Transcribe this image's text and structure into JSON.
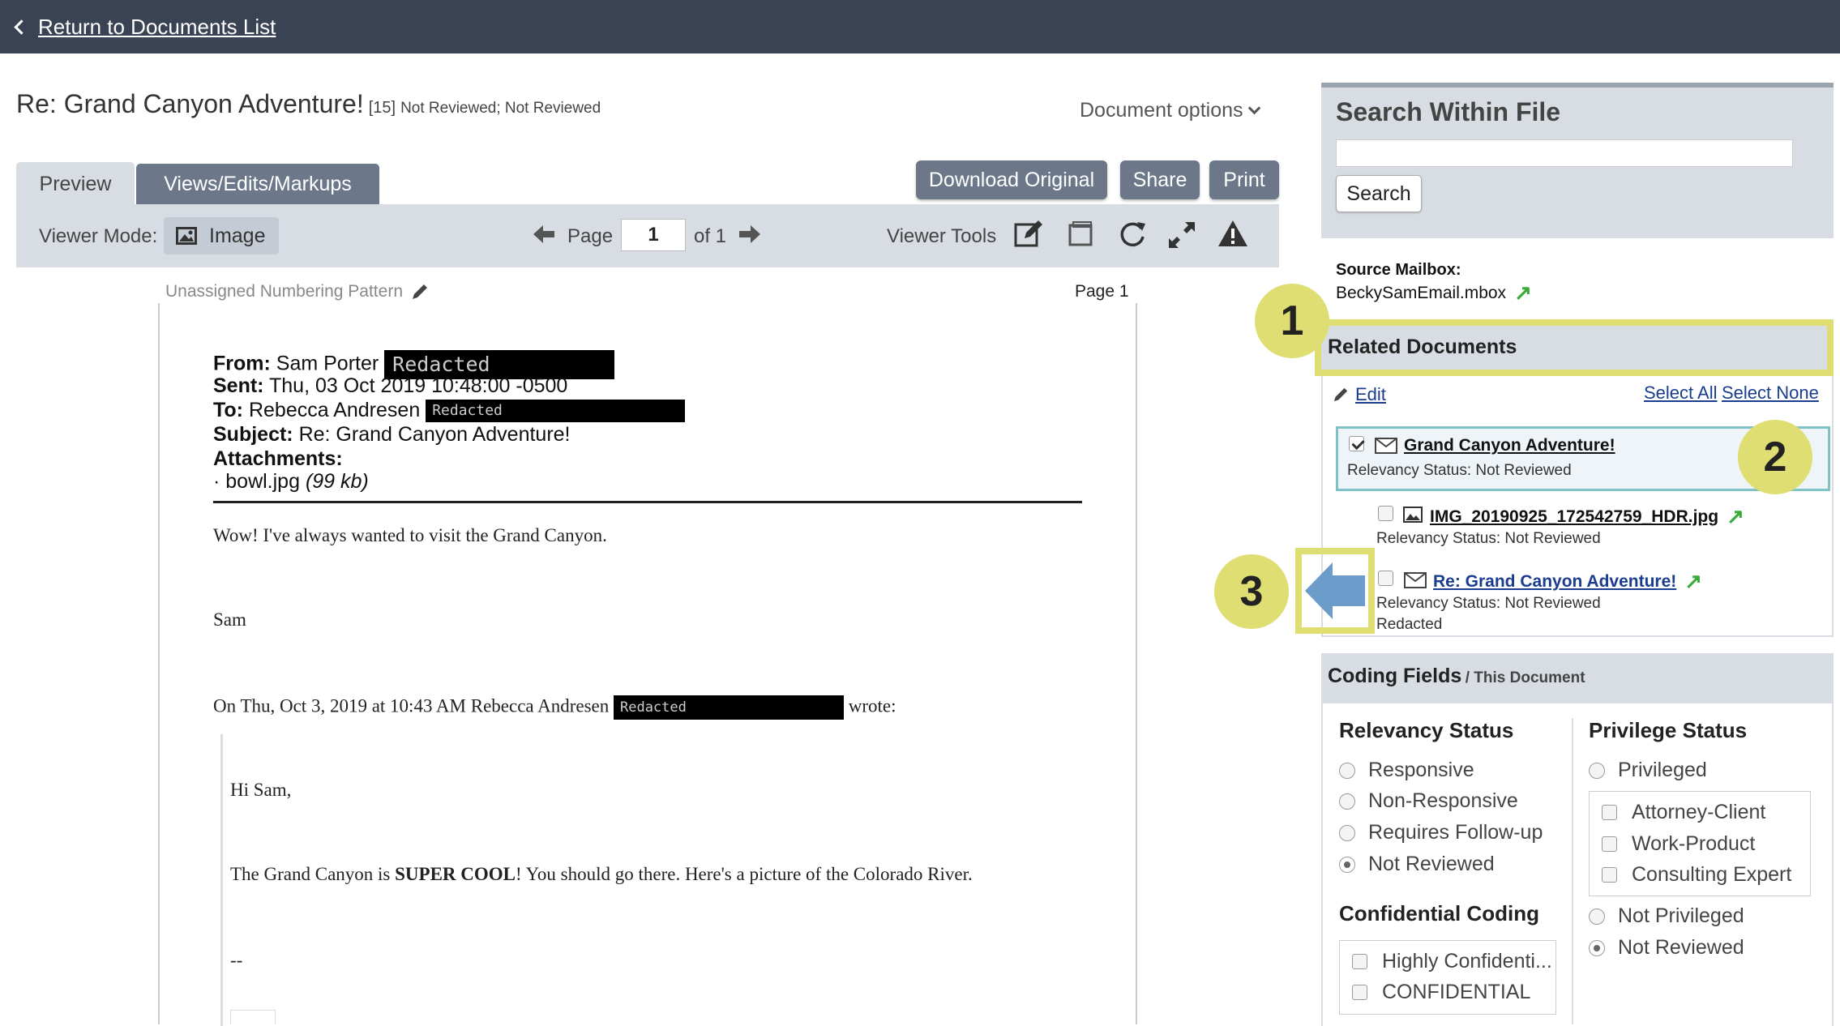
{
  "topbar": {
    "back_label": "Return to Documents List"
  },
  "document": {
    "title": "Re: Grand Canyon Adventure!",
    "number": "[15]",
    "status": "Not Reviewed; Not Reviewed",
    "options_label": "Document options"
  },
  "tabs": [
    {
      "label": "Preview"
    },
    {
      "label": "Views/Edits/Markups"
    }
  ],
  "actions": {
    "download": "Download Original",
    "share": "Share",
    "print": "Print"
  },
  "viewer": {
    "mode_label": "Viewer Mode:",
    "mode_value": "Image",
    "page_label": "Page",
    "page_value": "1",
    "of_label": "of 1",
    "tools_label": "Viewer Tools"
  },
  "page": {
    "numbering": "Unassigned Numbering Pattern",
    "page_label": "Page 1",
    "from_label": "From:",
    "from_value": "Sam Porter",
    "sent_label": "Sent:",
    "sent_value": "Thu, 03 Oct 2019 10:48:00 -0500",
    "to_label": "To:",
    "to_value": "Rebecca Andresen",
    "subject_label": "Subject:",
    "subject_value": "Re: Grand Canyon Adventure!",
    "attachments_label": "Attachments:",
    "attachment_name": "· bowl.jpg",
    "attachment_size": "(99 kb)",
    "redacted": "Redacted",
    "body_line1": "Wow! I've always wanted to visit the Grand Canyon.",
    "signature": "Sam",
    "reply_intro": "On Thu, Oct 3, 2019 at 10:43 AM Rebecca Andresen",
    "reply_wrote": "wrote:",
    "greeting": "Hi Sam,",
    "body2_pre": "The Grand Canyon is ",
    "body2_bold": "SUPER COOL",
    "body2_post": "! You should go there. Here's a picture of the Colorado River.",
    "dashes": "--"
  },
  "search": {
    "title": "Search Within File",
    "button": "Search"
  },
  "source": {
    "label": "Source Mailbox:",
    "value": "BeckySamEmail.mbox"
  },
  "related": {
    "title": "Related Documents",
    "edit": "Edit",
    "select_all": "Select All",
    "select_none": "Select None",
    "items": [
      {
        "name": "Grand Canyon Adventure!",
        "status": "Relevancy Status: Not Reviewed",
        "checked": true
      },
      {
        "name": "IMG_20190925_172542759_HDR.jpg",
        "status": "Relevancy Status: Not Reviewed",
        "checked": false
      },
      {
        "name": "Re: Grand Canyon Adventure!",
        "status": "Relevancy Status: Not Reviewed",
        "extra": "Redacted",
        "checked": false
      }
    ]
  },
  "coding": {
    "title": "Coding Fields",
    "subtitle": "/ This Document",
    "relevancy": {
      "title": "Relevancy Status",
      "options": [
        "Responsive",
        "Non-Responsive",
        "Requires Follow-up",
        "Not Reviewed"
      ],
      "selected": "Not Reviewed"
    },
    "confidential": {
      "title": "Confidential Coding",
      "options": [
        "Highly Confidenti...",
        "CONFIDENTIAL"
      ]
    },
    "privilege": {
      "title": "Privilege Status",
      "options_top": [
        "Privileged"
      ],
      "sub_options": [
        "Attorney-Client",
        "Work-Product",
        "Consulting Expert"
      ],
      "options_bottom": [
        "Not Privileged",
        "Not Reviewed"
      ],
      "selected": "Not Reviewed"
    }
  },
  "callouts": [
    "1",
    "2",
    "3"
  ],
  "colors": {
    "topbar": "#3a4354",
    "panel": "#d8dde3",
    "button": "#6c7889",
    "callout": "#dede72",
    "link": "#1a3d8f",
    "selected_border": "#7fc3c7"
  }
}
